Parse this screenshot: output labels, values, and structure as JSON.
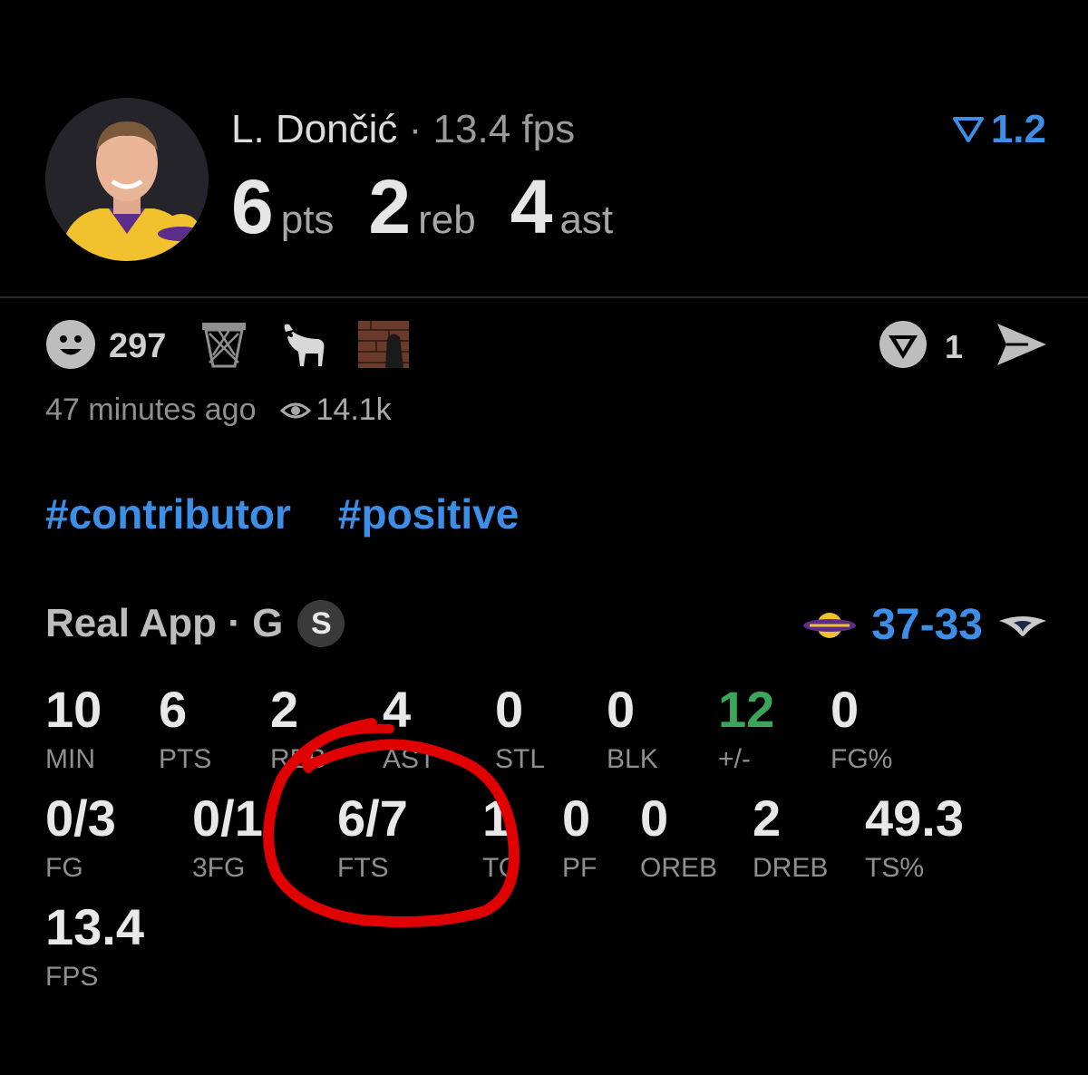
{
  "header": {
    "player_name": "L. Dončić",
    "separator": " · ",
    "fps_label": "13.4 fps",
    "rating_value": "1.2",
    "big_stats": [
      {
        "value": "6",
        "unit": "pts"
      },
      {
        "value": "2",
        "unit": "reb"
      },
      {
        "value": "4",
        "unit": "ast"
      }
    ]
  },
  "reactions": {
    "smile_count": "297",
    "icons": [
      "smile-icon",
      "basketball-hoop-icon",
      "goat-icon",
      "photo-thumbnail"
    ]
  },
  "actions": {
    "comment_count": "1"
  },
  "meta": {
    "time_ago": "47 minutes ago",
    "views": "14.1k"
  },
  "tags": [
    "#contributor",
    "#positive"
  ],
  "source": {
    "label": "Real App · G",
    "badge": "S",
    "score": "37-33"
  },
  "stats": [
    {
      "label": "MIN",
      "value": "10"
    },
    {
      "label": "PTS",
      "value": "6"
    },
    {
      "label": "REB",
      "value": "2"
    },
    {
      "label": "AST",
      "value": "4"
    },
    {
      "label": "STL",
      "value": "0"
    },
    {
      "label": "BLK",
      "value": "0"
    },
    {
      "label": "+/-",
      "value": "12"
    },
    {
      "label": "FG%",
      "value": "0"
    },
    {
      "label": "FG",
      "value": "0/3"
    },
    {
      "label": "3FG",
      "value": "0/1"
    },
    {
      "label": "FTS",
      "value": "6/7"
    },
    {
      "label": "TO",
      "value": "1"
    },
    {
      "label": "PF",
      "value": "0"
    },
    {
      "label": "OREB",
      "value": "0"
    },
    {
      "label": "DREB",
      "value": "2"
    },
    {
      "label": "TS%",
      "value": "49.3"
    },
    {
      "label": "FPS",
      "value": "13.4"
    }
  ],
  "colors": {
    "accent_blue": "#3c8ee6",
    "positive_green": "#3aa65c",
    "annotation_red": "#e00000",
    "background": "#000000"
  }
}
